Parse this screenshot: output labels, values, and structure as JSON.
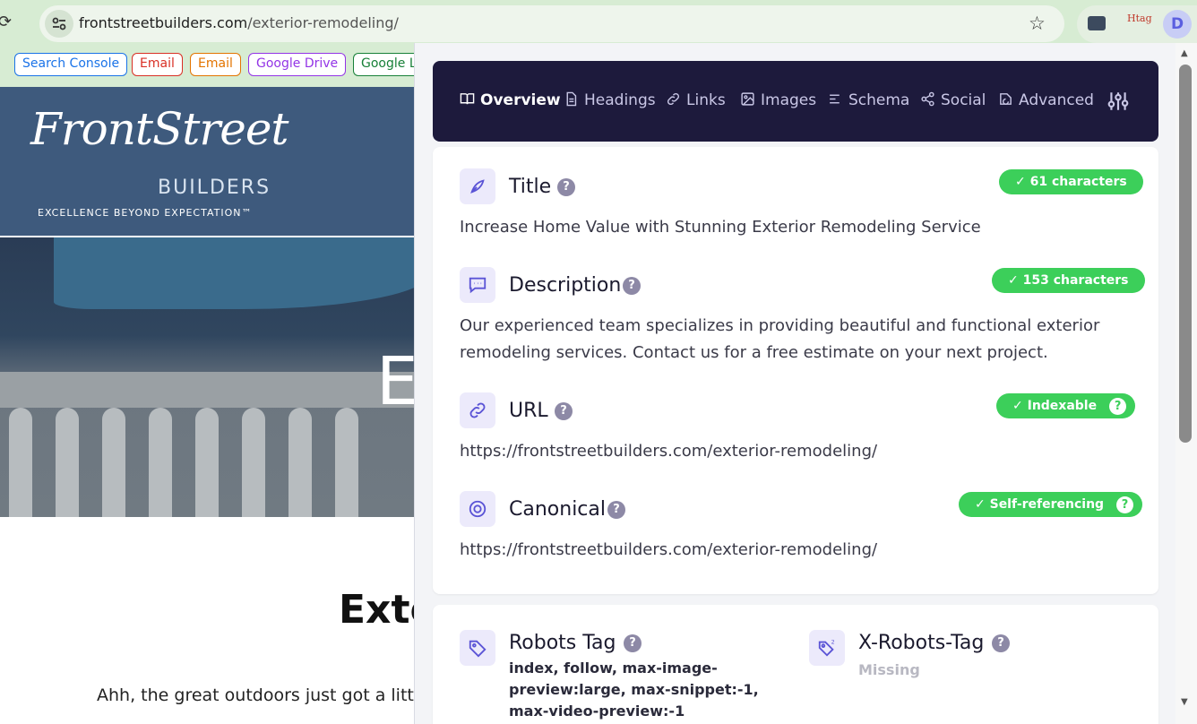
{
  "browser": {
    "url_host": "frontstreetbuilders.com",
    "url_path": "/exterior-remodeling/",
    "reload_icon": "reload-icon",
    "star_icon": "bookmark-star-icon",
    "ext_tag_text": "Htag",
    "ext_profile_letter": "D"
  },
  "bookmarks": [
    {
      "label": "Search Console",
      "color": "#1a73e8"
    },
    {
      "label": "Email",
      "color": "#d93025"
    },
    {
      "label": "Email",
      "color": "#e37400"
    },
    {
      "label": "Google Drive",
      "color": "#9334e6"
    },
    {
      "label": "Google L",
      "color": "#188038"
    }
  ],
  "page": {
    "logo_main": "FrontStreet",
    "logo_sub": "BUILDERS",
    "logo_tag": "EXCELLENCE BEYOND EXPECTATION™",
    "hero_letter": "E",
    "heading": "Exte",
    "paragraph": "Ahh, the great outdoors just got a litt"
  },
  "panel": {
    "nav": [
      {
        "label": "Overview",
        "icon": "book-icon",
        "active": true
      },
      {
        "label": "Headings",
        "icon": "document-icon",
        "active": false
      },
      {
        "label": "Links",
        "icon": "link-icon",
        "active": false
      },
      {
        "label": "Images",
        "icon": "image-icon",
        "active": false
      },
      {
        "label": "Schema",
        "icon": "schema-icon",
        "active": false
      },
      {
        "label": "Social",
        "icon": "share-icon",
        "active": false
      },
      {
        "label": "Advanced",
        "icon": "advanced-icon",
        "active": false
      }
    ],
    "settings_icon": "sliders-icon",
    "fields": {
      "title": {
        "label": "Title",
        "badge": "✓  61 characters",
        "value": "Increase Home Value with Stunning Exterior Remodeling Service"
      },
      "description": {
        "label": "Description",
        "badge": "✓  153 characters",
        "value": "Our experienced team specializes in providing beautiful and functional exterior remodeling services. Contact us for a free estimate on your next project."
      },
      "url": {
        "label": "URL",
        "badge": "✓  Indexable",
        "value": "https://frontstreetbuilders.com/exterior-remodeling/"
      },
      "canonical": {
        "label": "Canonical",
        "badge": "✓  Self-referencing",
        "value": "https://frontstreetbuilders.com/exterior-remodeling/"
      }
    },
    "robots": {
      "label": "Robots Tag",
      "value": "index, follow, max-image-preview:large, max-snippet:-1, max-video-preview:-1"
    },
    "xrobots": {
      "label": "X-Robots-Tag",
      "value": "Missing"
    },
    "help_glyph": "?",
    "accent_color": "#5b54d6",
    "badge_color": "#3ccf5a",
    "nav_bg": "#1d1a3c"
  }
}
